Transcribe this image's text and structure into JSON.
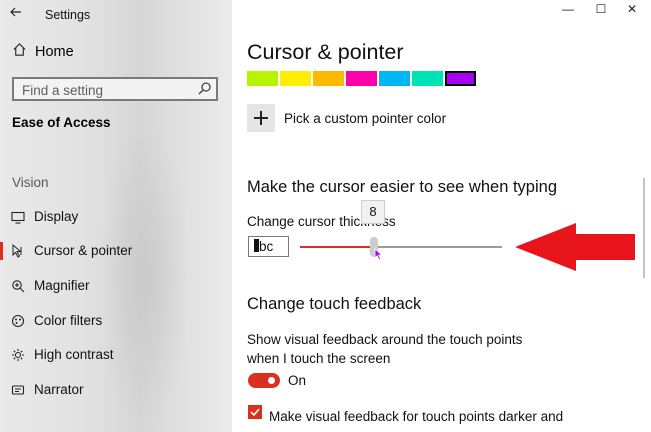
{
  "window": {
    "app_title": "Settings",
    "back_icon": "back-arrow-icon",
    "controls": {
      "minimize": "—",
      "maximize": "☐",
      "close": "✕"
    }
  },
  "sidebar": {
    "home_label": "Home",
    "search_placeholder": "Find a setting",
    "section_title": "Ease of Access",
    "group_label": "Vision",
    "items": [
      {
        "label": "Display",
        "icon": "display-icon"
      },
      {
        "label": "Cursor & pointer",
        "icon": "cursor-pointer-icon",
        "selected": true
      },
      {
        "label": "Magnifier",
        "icon": "magnifier-icon"
      },
      {
        "label": "Color filters",
        "icon": "color-filters-icon"
      },
      {
        "label": "High contrast",
        "icon": "high-contrast-icon"
      },
      {
        "label": "Narrator",
        "icon": "narrator-icon"
      }
    ]
  },
  "main": {
    "title": "Cursor & pointer",
    "pointer_colors": [
      "#b7f400",
      "#ffee00",
      "#ffb900",
      "#ff00a8",
      "#00b7f4",
      "#00e3b7",
      "#a800f4"
    ],
    "selected_color_index": 6,
    "custom_color_label": "Pick a custom pointer color",
    "typing_heading": "Make the cursor easier to see when typing",
    "thickness_label": "Change cursor thickness",
    "preview_text": "bc",
    "thickness": {
      "value": 8,
      "min": 1,
      "max": 20,
      "tooltip": "8"
    },
    "touch_heading": "Change touch feedback",
    "touch_desc_line1": "Show visual feedback around the touch points",
    "touch_desc_line2": "when I touch the screen",
    "toggle_state": "On",
    "checkbox_label": "Make visual feedback for touch points darker and",
    "accent_color": "#d9301f",
    "annotation_arrow_color": "#e8141c"
  }
}
